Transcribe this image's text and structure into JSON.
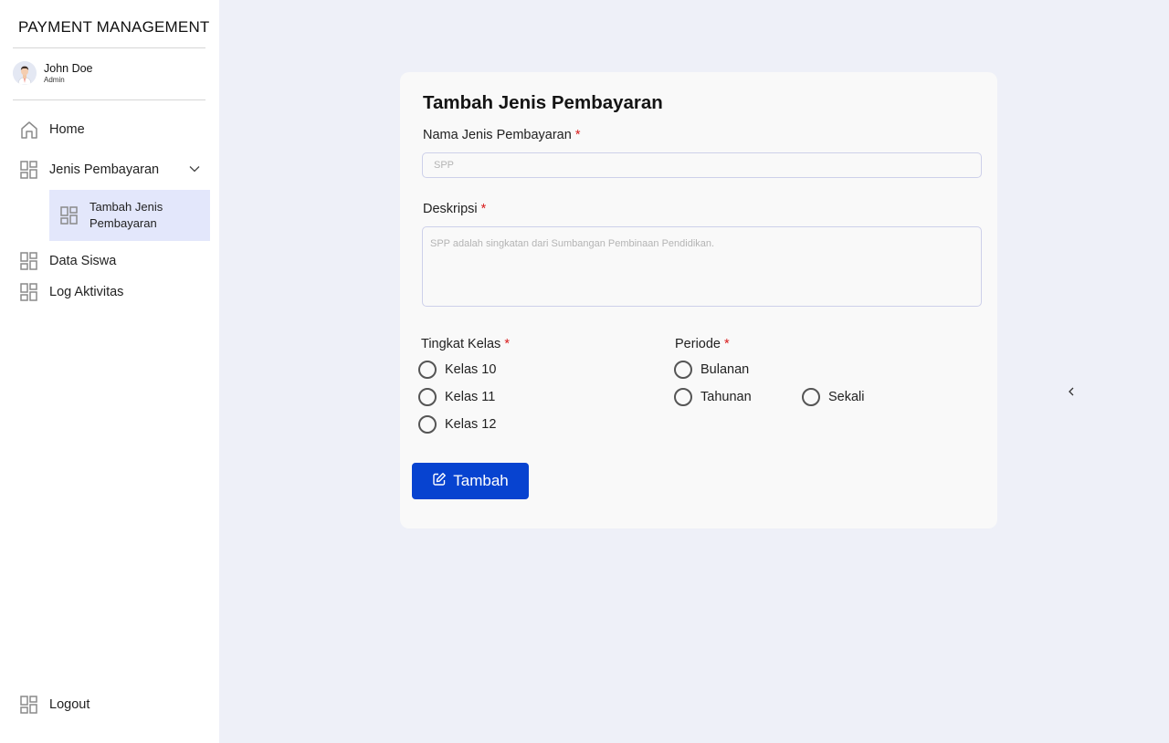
{
  "sidebar": {
    "brand": "PAYMENT MANAGEMENT",
    "user": {
      "name": "John Doe",
      "role": "Admin"
    },
    "nav": {
      "home": "Home",
      "jenis_pembayaran": "Jenis Pembayaran",
      "tambah_jenis_pembayaran": "Tambah Jenis Pembayaran",
      "data_siswa": "Data Siswa",
      "log_aktivitas": "Log Aktivitas",
      "logout": "Logout"
    },
    "active_color": "#e3e7fb"
  },
  "form": {
    "title": "Tambah Jenis Pembayaran",
    "required_mark": "*",
    "nama": {
      "label": "Nama Jenis Pembayaran",
      "placeholder": "SPP",
      "value": ""
    },
    "deskripsi": {
      "label": "Deskripsi",
      "placeholder": "SPP adalah singkatan dari Sumbangan Pembinaan Pendidikan.",
      "value": ""
    },
    "tingkat_kelas": {
      "label": "Tingkat Kelas",
      "options": [
        "Kelas 10",
        "Kelas 11",
        "Kelas 12"
      ],
      "selected": null
    },
    "periode": {
      "label": "Periode",
      "options": [
        "Bulanan",
        "Tahunan",
        "Sekali"
      ],
      "selected": null
    },
    "submit_label": "Tambah"
  },
  "colors": {
    "primary": "#0743d0",
    "required": "#d81b1b",
    "background": "#eef0f8"
  },
  "icons": {
    "home": "home-icon",
    "grid": "grid-icon",
    "chevron": "chevron-down-icon",
    "edit": "edit-icon",
    "collapse": "chevron-left-icon"
  }
}
